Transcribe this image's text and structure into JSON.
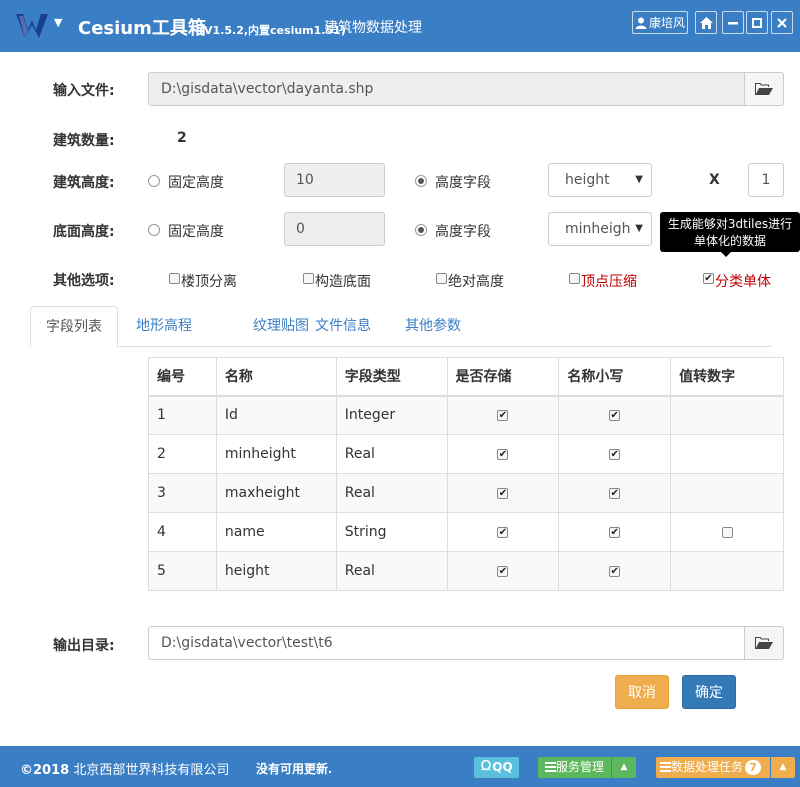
{
  "header": {
    "app_name": "Cesium工具箱",
    "version": "(V1.5.2,内置cesium1.51)",
    "subtitle": "建筑物数据处理",
    "user_name": "康培风",
    "brand_color": "#3a7fc5"
  },
  "form": {
    "input_file": {
      "label": "输入文件:",
      "value": "D:\\gisdata\\vector\\dayanta.shp"
    },
    "building_count": {
      "label": "建筑数量:",
      "value": "2"
    },
    "building_height": {
      "label": "建筑高度:",
      "fixed_label": "固定高度",
      "fixed_value": "10",
      "field_label": "高度字段",
      "field_value": "height",
      "mode": "field",
      "multiplier_label": "X",
      "multiplier_value": "1"
    },
    "base_height": {
      "label": "底面高度:",
      "fixed_label": "固定高度",
      "fixed_value": "0",
      "field_label": "高度字段",
      "field_value": "minheigh",
      "mode": "field"
    },
    "other_options": {
      "label": "其他选项:",
      "items": [
        {
          "label": "楼顶分离",
          "checked": false,
          "highlight": false
        },
        {
          "label": "构造底面",
          "checked": false,
          "highlight": false
        },
        {
          "label": "绝对高度",
          "checked": false,
          "highlight": false
        },
        {
          "label": "顶点压缩",
          "checked": false,
          "highlight": true
        },
        {
          "label": "分类单体",
          "checked": true,
          "highlight": true
        }
      ]
    },
    "tooltip": {
      "line1": "生成能够对3dtiles进行",
      "line2": "单体化的数据"
    }
  },
  "tabs": [
    {
      "label": "字段列表",
      "active": true
    },
    {
      "label": "地形高程",
      "active": false
    },
    {
      "label": "纹理贴图",
      "active": false
    },
    {
      "label": "文件信息",
      "active": false
    },
    {
      "label": "其他参数",
      "active": false
    }
  ],
  "fields_table": {
    "headers": [
      "编号",
      "名称",
      "字段类型",
      "是否存储",
      "名称小写",
      "值转数字"
    ],
    "rows": [
      {
        "id": "1",
        "name": "Id",
        "type": "Integer",
        "store": true,
        "lower": true,
        "to_number": null
      },
      {
        "id": "2",
        "name": "minheight",
        "type": "Real",
        "store": true,
        "lower": true,
        "to_number": null
      },
      {
        "id": "3",
        "name": "maxheight",
        "type": "Real",
        "store": true,
        "lower": true,
        "to_number": null
      },
      {
        "id": "4",
        "name": "name",
        "type": "String",
        "store": true,
        "lower": true,
        "to_number": false
      },
      {
        "id": "5",
        "name": "height",
        "type": "Real",
        "store": true,
        "lower": true,
        "to_number": null
      }
    ]
  },
  "output": {
    "label": "输出目录:",
    "value": "D:\\gisdata\\vector\\test\\t6"
  },
  "buttons": {
    "cancel": "取消",
    "ok": "确定"
  },
  "statusbar": {
    "copyright_year": "©2018",
    "company": "北京西部世界科技有限公司",
    "update_status": "没有可用更新.",
    "qq_label": "QQ",
    "service_label": "服务管理",
    "task_label": "数据处理任务",
    "task_count": "7"
  }
}
